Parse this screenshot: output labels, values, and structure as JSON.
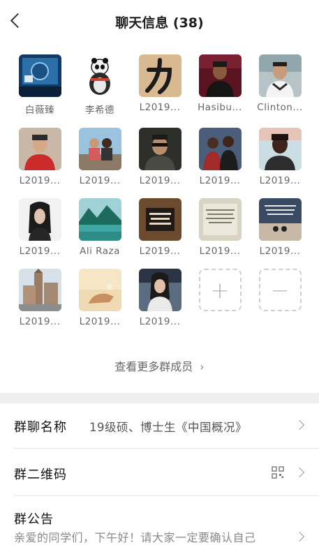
{
  "header": {
    "title": "聊天信息 (38)"
  },
  "members": [
    {
      "name": "白薇臻",
      "avatar": "blue-screen-photo"
    },
    {
      "name": "李希德",
      "avatar": "panda-photo"
    },
    {
      "name": "L2019...",
      "avatar": "calligraphy-li-photo"
    },
    {
      "name": "Hasibu...",
      "avatar": "man-portrait-photo"
    },
    {
      "name": "Clinton...",
      "avatar": "man-portrait-photo"
    },
    {
      "name": "L2019...",
      "avatar": "man-red-jacket-photo"
    },
    {
      "name": "L2019...",
      "avatar": "couple-photo"
    },
    {
      "name": "L2019...",
      "avatar": "man-sunglasses-photo"
    },
    {
      "name": "L2019...",
      "avatar": "two-men-photo"
    },
    {
      "name": "L2019...",
      "avatar": "woman-portrait-photo"
    },
    {
      "name": "L2019...",
      "avatar": "woman-portrait-photo"
    },
    {
      "name": "Ali Raza",
      "avatar": "mountain-lake-photo"
    },
    {
      "name": "L2019...",
      "avatar": "text-quote-photo"
    },
    {
      "name": "L2019...",
      "avatar": "text-quote-photo"
    },
    {
      "name": "L2019...",
      "avatar": "sunset-quote-photo"
    },
    {
      "name": "L2019...",
      "avatar": "church-photo"
    },
    {
      "name": "L2019...",
      "avatar": "hand-sunset-photo"
    },
    {
      "name": "L2019...",
      "avatar": "woman-car-photo"
    }
  ],
  "add_member": {
    "icon": "plus-icon"
  },
  "remove_member": {
    "icon": "minus-icon"
  },
  "view_more": {
    "label": "查看更多群成员"
  },
  "group_name": {
    "label": "群聊名称",
    "value": "19级硕、博士生《中国概况》"
  },
  "group_qr": {
    "label": "群二维码",
    "icon": "qr-code-icon"
  },
  "group_notice": {
    "label": "群公告",
    "text": "亲爱的同学们，下午好！请大家一定要确认自己"
  },
  "colors": {
    "separator": "#efefef",
    "muted_text": "#666666"
  }
}
